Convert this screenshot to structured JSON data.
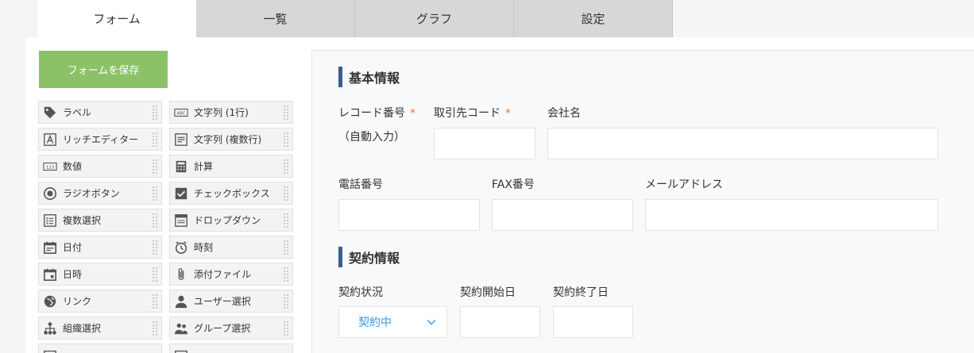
{
  "tabs": [
    {
      "label": "フォーム",
      "active": true
    },
    {
      "label": "一覧",
      "active": false
    },
    {
      "label": "グラフ",
      "active": false
    },
    {
      "label": "設定",
      "active": false
    }
  ],
  "palette": {
    "save_label": "フォームを保存",
    "items": [
      {
        "label": "ラベル",
        "icon": "tag-icon"
      },
      {
        "label": "文字列 (1行)",
        "icon": "abc-icon"
      },
      {
        "label": "リッチエディター",
        "icon": "rich-editor-icon"
      },
      {
        "label": "文字列 (複数行)",
        "icon": "multiline-text-icon"
      },
      {
        "label": "数値",
        "icon": "number-icon"
      },
      {
        "label": "計算",
        "icon": "calculator-icon"
      },
      {
        "label": "ラジオボタン",
        "icon": "radio-icon"
      },
      {
        "label": "チェックボックス",
        "icon": "checkbox-icon"
      },
      {
        "label": "複数選択",
        "icon": "multi-select-icon"
      },
      {
        "label": "ドロップダウン",
        "icon": "dropdown-icon"
      },
      {
        "label": "日付",
        "icon": "calendar-icon"
      },
      {
        "label": "時刻",
        "icon": "clock-icon"
      },
      {
        "label": "日時",
        "icon": "datetime-icon"
      },
      {
        "label": "添付ファイル",
        "icon": "paperclip-icon"
      },
      {
        "label": "リンク",
        "icon": "globe-icon"
      },
      {
        "label": "ユーザー選択",
        "icon": "user-icon"
      },
      {
        "label": "組織選択",
        "icon": "org-icon"
      },
      {
        "label": "グループ選択",
        "icon": "group-icon"
      }
    ]
  },
  "form": {
    "basic": {
      "title": "基本情報",
      "record_no_label": "レコード番号",
      "record_no_required": "*",
      "record_no_auto": "（自動入力）",
      "client_code_label": "取引先コード",
      "client_code_required": "*",
      "company_label": "会社名",
      "phone_label": "電話番号",
      "fax_label": "FAX番号",
      "email_label": "メールアドレス"
    },
    "contract": {
      "title": "契約情報",
      "status_label": "契約状況",
      "status_value": "契約中",
      "start_label": "契約開始日",
      "end_label": "契約終了日"
    }
  },
  "colors": {
    "accent_green": "#8cc267",
    "section_bar": "#3a5f8c",
    "required": "#e07b39",
    "link_blue": "#3498db"
  }
}
